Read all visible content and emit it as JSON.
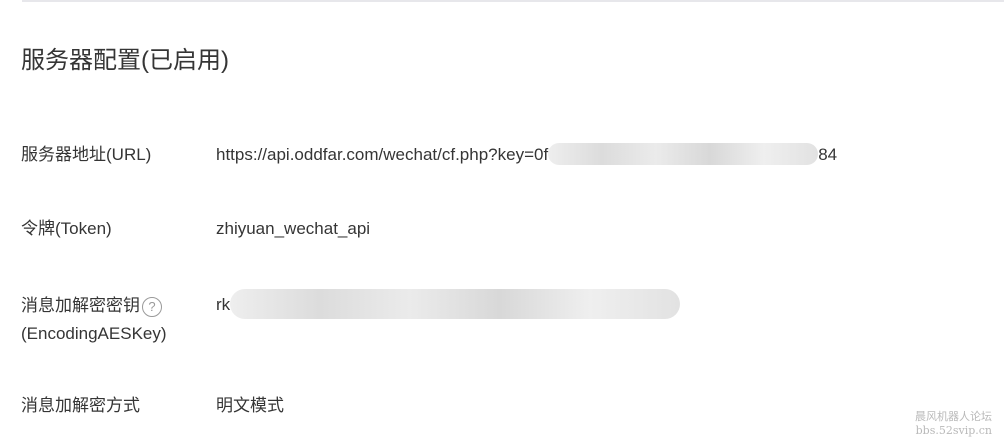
{
  "section": {
    "title": "服务器配置(已启用)"
  },
  "fields": {
    "url": {
      "label": "服务器地址(URL)",
      "value_prefix": "https://api.oddfar.com/wechat/cf.php?key=0f",
      "value_suffix": "84"
    },
    "token": {
      "label": "令牌(Token)",
      "value": "zhiyuan_wechat_api"
    },
    "aes_key": {
      "label_line1": "消息加解密密钥",
      "label_line2": "(EncodingAESKey)",
      "help_icon": "?",
      "value_prefix": "rk"
    },
    "encrypt_mode": {
      "label": "消息加解密方式",
      "value": "明文模式"
    }
  },
  "watermark": {
    "line1": "晨风机器人论坛",
    "line2": "bbs.52svip.cn"
  }
}
